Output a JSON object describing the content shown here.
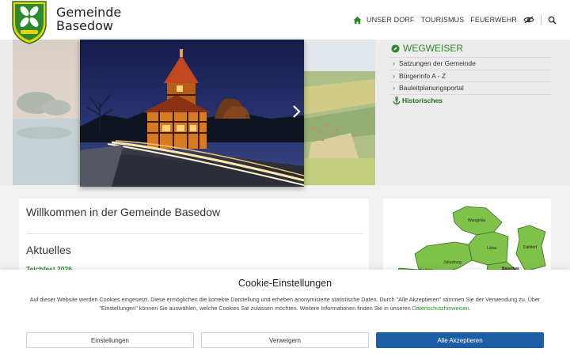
{
  "header": {
    "brand_line1": "Gemeinde",
    "brand_line2": "Basedow",
    "nav": [
      {
        "label": "UNSER DORF"
      },
      {
        "label": "TOURISMUS"
      },
      {
        "label": "FEUERWEHR"
      }
    ]
  },
  "wegweiser": {
    "title": "WEGWEISER",
    "items": [
      {
        "label": "Satzungen der Gemeinde"
      },
      {
        "label": "Bürgerinfo A - Z"
      },
      {
        "label": "Bauleitplanungsportal"
      },
      {
        "label": "Historisches"
      }
    ]
  },
  "main": {
    "welcome_title": "Willkommen in der Gemeinde Basedow",
    "section_title": "Aktuelles",
    "news_item": "Teichfest 2026"
  },
  "map": {
    "labels": [
      "Wangelau",
      "Dalldorf",
      "Lütau",
      "Juliusburg",
      "Krukow",
      "Basedow"
    ]
  },
  "cookie": {
    "title": "Cookie-Einstellungen",
    "text_before_link": "Auf dieser Website werden Cookies eingesetzt. Diese ermöglichen die korrekte Darstellung und erheben anonymisierte statistische Daten. Durch \"Alle Akzeptieren\" stimmen Sie der Verwendung zu. Über \"Einstellungen\" können Sie auswählen, welche Cookies Sie zulassen möchten. Weitere Informationen finden Sie in unseren ",
    "link_text": "Datenschutzhinweisen",
    "text_after_link": ".",
    "buttons": {
      "settings": "Einstellungen",
      "deny": "Verweigern",
      "accept": "Alle Akzeptieren"
    }
  },
  "colors": {
    "accent_green": "#2a8a2a",
    "accept_blue": "#1c5ea6"
  }
}
